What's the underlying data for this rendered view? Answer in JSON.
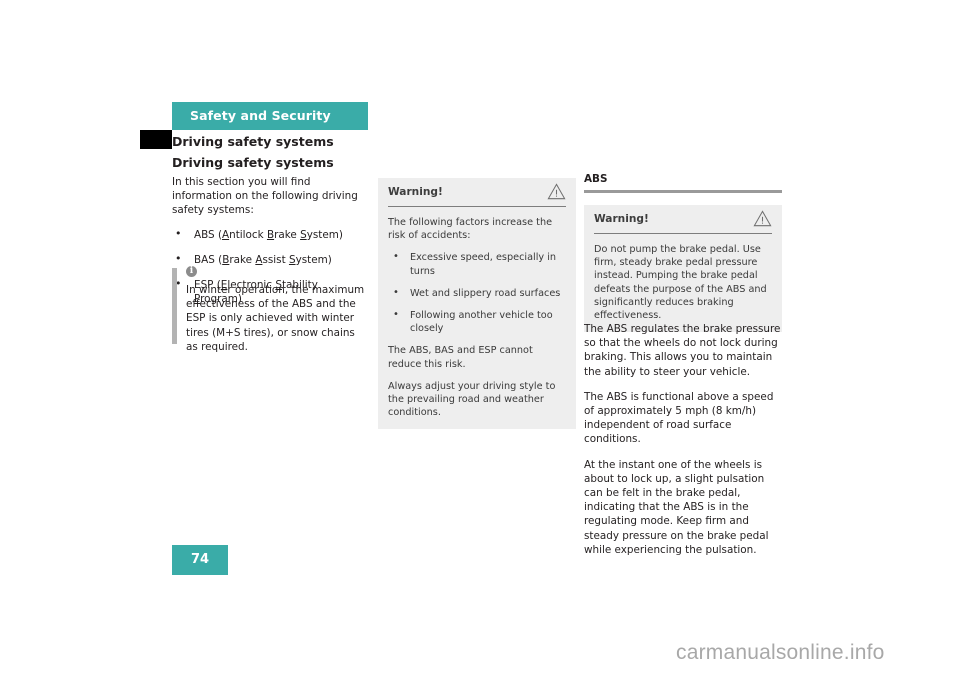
{
  "page": {
    "chapter_banner": "Safety and Security",
    "running_head": "Driving safety systems",
    "section_title": "Driving safety systems",
    "folio": "74",
    "watermark": "carmanualsonline.info",
    "colors": {
      "accent_teal": "#3aaca8",
      "tab_black": "#000000",
      "warning_bg": "#eeeeee",
      "rule_gray": "#9a9a9a",
      "info_rule_gray": "#b3b3b3",
      "body_text": "#231f20",
      "watermark_gray": "#a8a8a8"
    }
  },
  "left_column": {
    "intro": "In this section you will find information on the following driving safety systems:",
    "bullets": [
      {
        "prefix": "ABS (",
        "parts": [
          {
            "u": "A",
            "rest": "ntilock "
          },
          {
            "u": "B",
            "rest": "rake "
          },
          {
            "u": "S",
            "rest": "ystem"
          }
        ],
        "suffix": ")"
      },
      {
        "prefix": "BAS (",
        "parts": [
          {
            "u": "B",
            "rest": "rake "
          },
          {
            "u": "A",
            "rest": "ssist "
          },
          {
            "u": "S",
            "rest": "ystem"
          }
        ],
        "suffix": ")"
      },
      {
        "prefix": "ESP (",
        "parts": [
          {
            "u": "E",
            "rest": "lectronic "
          },
          {
            "u": "S",
            "rest": "tability "
          },
          {
            "u": "P",
            "rest": "rogram"
          }
        ],
        "suffix": ")"
      }
    ],
    "info_box": {
      "icon": "info-icon",
      "text": "In winter operation, the maximum effectiveness of the ABS and the ESP is only achieved with winter tires (M+S tires), or snow chains as required."
    }
  },
  "middle_column": {
    "warning": {
      "title": "Warning!",
      "icon": "warning-triangle-icon",
      "intro": "The following factors increase the risk of accidents:",
      "bullets": [
        "Excessive speed, especially in turns",
        "Wet and slippery road surfaces",
        "Following another vehicle too closely"
      ],
      "paragraphs": [
        "The ABS, BAS and ESP cannot reduce this risk.",
        "Always adjust your driving style to the prevailing road and weather conditions."
      ]
    }
  },
  "right_column": {
    "heading": "ABS",
    "warning": {
      "title": "Warning!",
      "icon": "warning-triangle-icon",
      "text": "Do not pump the brake pedal. Use firm, steady brake pedal pressure instead. Pumping the brake pedal defeats the purpose of the ABS and significantly reduces braking effectiveness."
    },
    "paragraphs": [
      "The ABS regulates the brake pressure so that the wheels do not lock during braking. This allows you to maintain the ability to steer your vehicle.",
      "The ABS is functional above a speed of approximately 5 mph (8 km/h) independent of road surface conditions.",
      "At the instant one of the wheels is about to lock up, a slight pulsation can be felt in the brake pedal, indicating that the ABS is in the regulating mode. Keep firm and steady pressure on the brake pedal while experiencing the pulsation."
    ]
  }
}
